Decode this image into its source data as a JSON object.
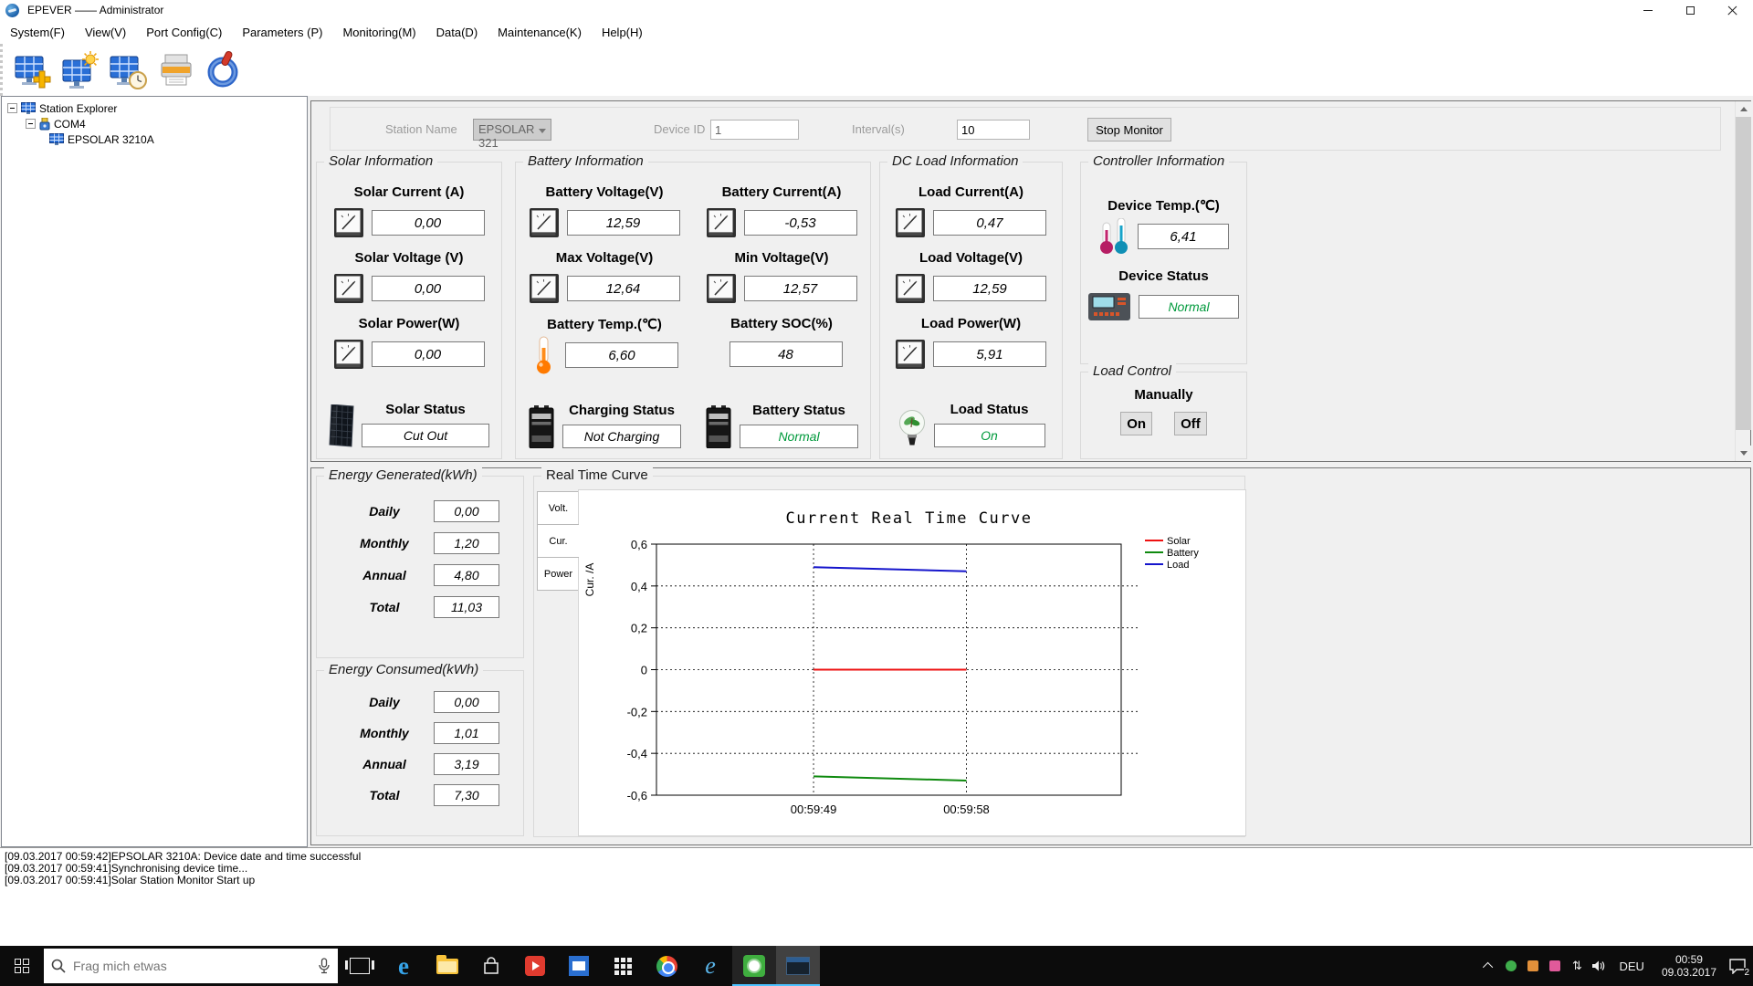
{
  "window": {
    "title": "EPEVER —— Administrator"
  },
  "menu": {
    "items": [
      "System(F)",
      "View(V)",
      "Port Config(C)",
      "Parameters (P)",
      "Monitoring(M)",
      "Data(D)",
      "Maintenance(K)",
      "Help(H)"
    ]
  },
  "toolbar": {
    "icons": [
      "add-station-icon",
      "station-sun-icon",
      "station-clock-icon",
      "print-icon",
      "power-icon"
    ]
  },
  "tree": {
    "root": "Station Explorer",
    "port": "COM4",
    "device": "EPSOLAR 3210A"
  },
  "form": {
    "station_name": {
      "label": "Station Name",
      "value": "EPSOLAR 321"
    },
    "device_id": {
      "label": "Device ID",
      "value": "1"
    },
    "interval": {
      "label": "Interval(s)",
      "value": "10"
    },
    "stop_button": "Stop Monitor"
  },
  "panels": {
    "solar": {
      "title": "Solar Information",
      "fields": [
        {
          "label": "Solar Current (A)",
          "value": "0,00"
        },
        {
          "label": "Solar Voltage (V)",
          "value": "0,00"
        },
        {
          "label": "Solar Power(W)",
          "value": "0,00"
        }
      ],
      "status": {
        "label": "Solar Status",
        "value": "Cut Out",
        "color": "#000000"
      }
    },
    "battery": {
      "title": "Battery Information",
      "fields": [
        {
          "label": "Battery Voltage(V)",
          "value": "12,59"
        },
        {
          "label": "Battery Current(A)",
          "value": "-0,53"
        },
        {
          "label": "Max Voltage(V)",
          "value": "12,64"
        },
        {
          "label": "Min Voltage(V)",
          "value": "12,57"
        },
        {
          "label": "Battery Temp.(℃)",
          "value": "6,60"
        },
        {
          "label": "Battery SOC(%)",
          "value": "48"
        }
      ],
      "charging_status": {
        "label": "Charging Status",
        "value": "Not Charging",
        "color": "#000000"
      },
      "battery_status": {
        "label": "Battery Status",
        "value": "Normal",
        "color": "#009a3c"
      }
    },
    "dc_load": {
      "title": "DC Load Information",
      "fields": [
        {
          "label": "Load Current(A)",
          "value": "0,47"
        },
        {
          "label": "Load Voltage(V)",
          "value": "12,59"
        },
        {
          "label": "Load Power(W)",
          "value": "5,91"
        }
      ],
      "status": {
        "label": "Load Status",
        "value": "On",
        "color": "#009a3c"
      }
    },
    "controller": {
      "title": "Controller Information",
      "temp": {
        "label": "Device Temp.(℃)",
        "value": "6,41"
      },
      "status": {
        "label": "Device Status",
        "value": "Normal",
        "color": "#009a3c"
      }
    },
    "load_control": {
      "title": "Load Control",
      "mode_label": "Manually",
      "on_button": "On",
      "off_button": "Off"
    }
  },
  "energy_generated": {
    "title": "Energy Generated(kWh)",
    "rows": [
      {
        "label": "Daily",
        "value": "0,00"
      },
      {
        "label": "Monthly",
        "value": "1,20"
      },
      {
        "label": "Annual",
        "value": "4,80"
      },
      {
        "label": "Total",
        "value": "11,03"
      }
    ]
  },
  "energy_consumed": {
    "title": "Energy Consumed(kWh)",
    "rows": [
      {
        "label": "Daily",
        "value": "0,00"
      },
      {
        "label": "Monthly",
        "value": "1,01"
      },
      {
        "label": "Annual",
        "value": "3,19"
      },
      {
        "label": "Total",
        "value": "7,30"
      }
    ]
  },
  "real_time_curve": {
    "title": "Real Time Curve",
    "tabs": [
      {
        "label": "Volt."
      },
      {
        "label": "Cur."
      },
      {
        "label": "Power"
      }
    ],
    "active_tab": "Cur."
  },
  "chart_data": {
    "type": "line",
    "title": "Current Real Time Curve",
    "ylabel": "Cur. /A",
    "ylim": [
      -0.6,
      0.6
    ],
    "ytick_values": [
      0.6,
      0.4,
      0.2,
      0,
      -0.2,
      -0.4,
      -0.6
    ],
    "ytick_labels": [
      "0,6",
      "0,4",
      "0,2",
      "0",
      "-0,2",
      "-0,4",
      "-0,6"
    ],
    "x_ticks": [
      {
        "pos": 0.338,
        "label": "00:59:49"
      },
      {
        "pos": 0.667,
        "label": "00:59:58"
      }
    ],
    "grid": true,
    "legend_position": "top-right",
    "series": [
      {
        "name": "Solar",
        "color": "#ee1111",
        "points": [
          [
            0.338,
            0.0
          ],
          [
            0.667,
            0.0
          ]
        ]
      },
      {
        "name": "Battery",
        "color": "#0f8a0f",
        "points": [
          [
            0.338,
            -0.51
          ],
          [
            0.667,
            -0.53
          ]
        ]
      },
      {
        "name": "Load",
        "color": "#1515cc",
        "points": [
          [
            0.338,
            0.49
          ],
          [
            0.667,
            0.47
          ]
        ]
      }
    ]
  },
  "log": {
    "lines": [
      "[09.03.2017 00:59:42]EPSOLAR 3210A: Device date and time successful",
      "[09.03.2017 00:59:41]Synchronising device time...",
      "[09.03.2017 00:59:41]Solar Station Monitor Start up"
    ]
  },
  "taskbar": {
    "search_placeholder": "Frag mich etwas",
    "language": "DEU",
    "time": "00:59",
    "date": "09.03.2017",
    "notification_count": "2",
    "icons": [
      "start-icon",
      "search-icon",
      "microphone-icon",
      "task-view-icon",
      "edge-icon",
      "file-explorer-icon",
      "store-icon",
      "media-app-icon",
      "mail-app-icon",
      "apps-grid-icon",
      "chrome-icon",
      "internet-explorer-icon",
      "solar-monitor-app-icon",
      "com-monitor-app-icon",
      "chevron-up-icon",
      "eco-tray-icon",
      "orange-tray-icon",
      "pink-tray-icon",
      "updown-tray-icon",
      "volume-tray-icon",
      "action-center-icon"
    ]
  }
}
